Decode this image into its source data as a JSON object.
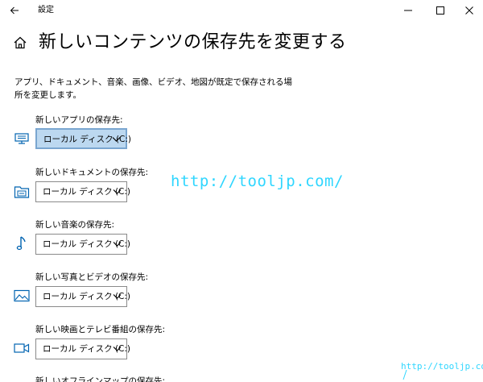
{
  "titlebar": {
    "title": "設定",
    "back_icon": "back-arrow-icon",
    "minimize_icon": "minimize-icon",
    "maximize_icon": "maximize-icon",
    "close_icon": "close-icon"
  },
  "page": {
    "home_icon": "home-icon",
    "title": "新しいコンテンツの保存先を変更する",
    "description": "アプリ、ドキュメント、音楽、画像、ビデオ、地図が既定で保存される場所を変更します。"
  },
  "sections": [
    {
      "label": "新しいアプリの保存先:",
      "icon": "monitor-icon",
      "value": "ローカル ディスク (C:)",
      "focused": true
    },
    {
      "label": "新しいドキュメントの保存先:",
      "icon": "document-drive-icon",
      "value": "ローカル ディスク (C:)",
      "focused": false
    },
    {
      "label": "新しい音楽の保存先:",
      "icon": "music-note-icon",
      "value": "ローカル ディスク (C:)",
      "focused": false
    },
    {
      "label": "新しい写真とビデオの保存先:",
      "icon": "picture-icon",
      "value": "ローカル ディスク (C:)",
      "focused": false
    },
    {
      "label": "新しい映画とテレビ番組の保存先:",
      "icon": "video-camera-icon",
      "value": "ローカル ディスク (C:)",
      "focused": false
    },
    {
      "label": "新しいオフラインマップの保存先:",
      "icon": "map-icon",
      "value": "",
      "focused": false
    }
  ],
  "watermarks": {
    "center": "http://tooljp.com/",
    "corner": "http://tooljp.com"
  },
  "colors": {
    "accent_icon": "#0063b1",
    "focused_dropdown_bg": "#bcd8f0",
    "watermark": "#2fd6ff"
  }
}
